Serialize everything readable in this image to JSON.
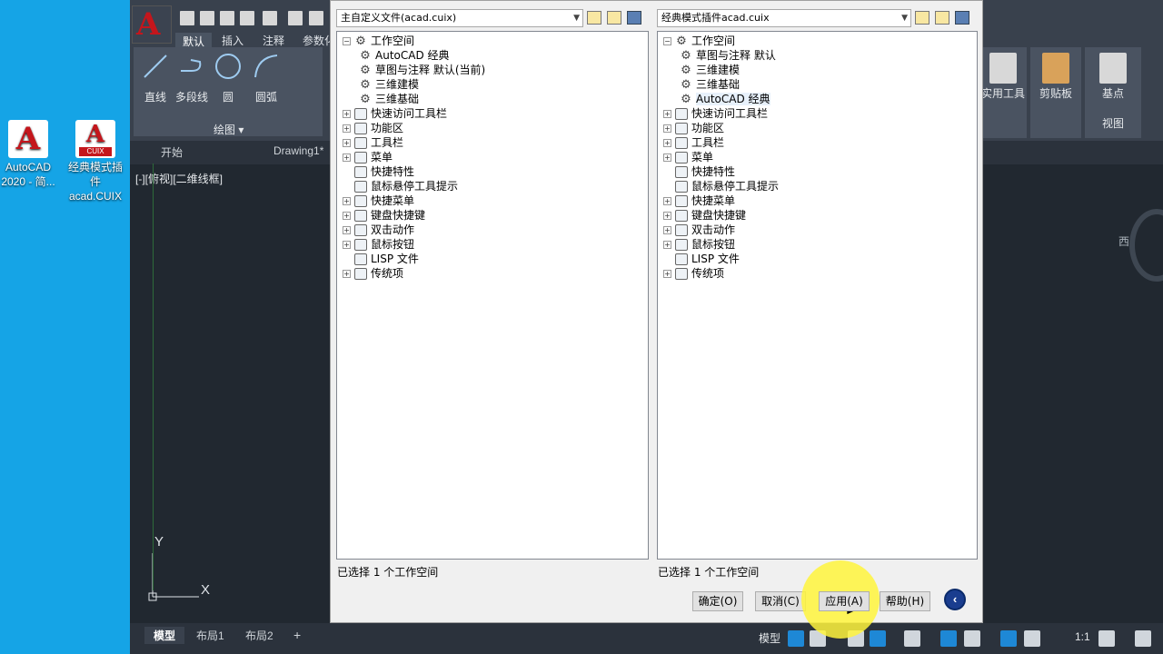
{
  "desktop": {
    "icons": [
      {
        "label": "AutoCAD 2020 - 简...",
        "name": "autocad-desktop-icon"
      },
      {
        "label": "经典模式插件 acad.CUIX",
        "name": "cuix-desktop-icon",
        "badge": "CUIX"
      }
    ]
  },
  "autocad": {
    "ribbon_tabs": [
      "默认",
      "插入",
      "注释",
      "参数化"
    ],
    "draw_tools": [
      "直线",
      "多段线",
      "圆",
      "圆弧"
    ],
    "draw_panel_title": "绘图",
    "right_panels": [
      "实用工具",
      "剪贴板",
      "基点",
      "视图"
    ],
    "file_tabs": [
      "开始",
      "Drawing1*"
    ],
    "viewport_label": "[-][俯视][二维线框]",
    "compass_label": "西",
    "ucs": {
      "x": "X",
      "y": "Y"
    },
    "layout_tabs": [
      "模型",
      "布局1",
      "布局2"
    ],
    "add_tab": "+",
    "status_model": "模型",
    "status_scale": "1:1"
  },
  "dialog": {
    "left": {
      "file_select": "主自定义文件(acad.cuix)",
      "tree": [
        {
          "label": "工作空间",
          "level": 0,
          "expander": "−",
          "icon": "gear"
        },
        {
          "label": "AutoCAD 经典",
          "level": 1,
          "icon": "gear"
        },
        {
          "label": "草图与注释 默认(当前)",
          "level": 1,
          "icon": "gear"
        },
        {
          "label": "三维建模",
          "level": 1,
          "icon": "gear"
        },
        {
          "label": "三维基础",
          "level": 1,
          "icon": "gear"
        },
        {
          "label": "快速访问工具栏",
          "level": 0,
          "expander": "+",
          "icon": "item"
        },
        {
          "label": "功能区",
          "level": 0,
          "expander": "+",
          "icon": "item"
        },
        {
          "label": "工具栏",
          "level": 0,
          "expander": "+",
          "icon": "item"
        },
        {
          "label": "菜单",
          "level": 0,
          "expander": "+",
          "icon": "item"
        },
        {
          "label": "快捷特性",
          "level": 0,
          "icon": "item"
        },
        {
          "label": "鼠标悬停工具提示",
          "level": 0,
          "icon": "item"
        },
        {
          "label": "快捷菜单",
          "level": 0,
          "expander": "+",
          "icon": "item"
        },
        {
          "label": "键盘快捷键",
          "level": 0,
          "expander": "+",
          "icon": "item"
        },
        {
          "label": "双击动作",
          "level": 0,
          "expander": "+",
          "icon": "item"
        },
        {
          "label": "鼠标按钮",
          "level": 0,
          "expander": "+",
          "icon": "item"
        },
        {
          "label": "LISP 文件",
          "level": 0,
          "icon": "item"
        },
        {
          "label": "传统项",
          "level": 0,
          "expander": "+",
          "icon": "item"
        }
      ],
      "status": "已选择 1 个工作空间"
    },
    "right": {
      "file_select": "经典模式插件acad.cuix",
      "tree": [
        {
          "label": "工作空间",
          "level": 0,
          "expander": "−",
          "icon": "gear"
        },
        {
          "label": "草图与注释 默认",
          "level": 1,
          "icon": "gear"
        },
        {
          "label": "三维建模",
          "level": 1,
          "icon": "gear"
        },
        {
          "label": "三维基础",
          "level": 1,
          "icon": "gear"
        },
        {
          "label": "AutoCAD 经典",
          "level": 1,
          "icon": "gear",
          "selected": true
        },
        {
          "label": "快速访问工具栏",
          "level": 0,
          "expander": "+",
          "icon": "item"
        },
        {
          "label": "功能区",
          "level": 0,
          "expander": "+",
          "icon": "item"
        },
        {
          "label": "工具栏",
          "level": 0,
          "expander": "+",
          "icon": "item"
        },
        {
          "label": "菜单",
          "level": 0,
          "expander": "+",
          "icon": "item"
        },
        {
          "label": "快捷特性",
          "level": 0,
          "icon": "item"
        },
        {
          "label": "鼠标悬停工具提示",
          "level": 0,
          "icon": "item"
        },
        {
          "label": "快捷菜单",
          "level": 0,
          "expander": "+",
          "icon": "item"
        },
        {
          "label": "键盘快捷键",
          "level": 0,
          "expander": "+",
          "icon": "item"
        },
        {
          "label": "双击动作",
          "level": 0,
          "expander": "+",
          "icon": "item"
        },
        {
          "label": "鼠标按钮",
          "level": 0,
          "expander": "+",
          "icon": "item"
        },
        {
          "label": "LISP 文件",
          "level": 0,
          "icon": "item"
        },
        {
          "label": "传统项",
          "level": 0,
          "expander": "+",
          "icon": "item"
        }
      ],
      "status": "已选择 1 个工作空间"
    },
    "buttons": {
      "ok": "确定(O)",
      "cancel": "取消(C)",
      "apply": "应用(A)",
      "help": "帮助(H)"
    }
  },
  "colors": {
    "desktop": "#15a4e6",
    "ribbon": "#39414d",
    "canvas": "#212830",
    "dialog": "#f0f0f0",
    "highlight": "#fff53c"
  }
}
